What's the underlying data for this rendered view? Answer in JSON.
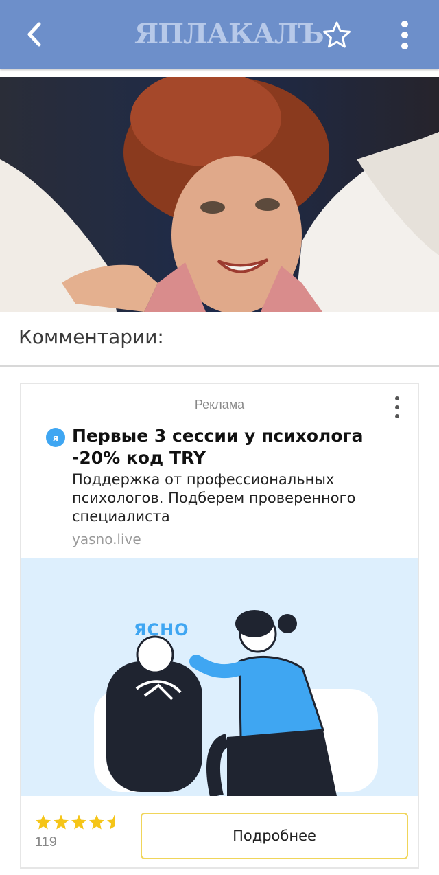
{
  "header": {
    "logo_text": "ЯПЛАКАЛЪ",
    "back_icon": "chevron-left-icon",
    "favorite_icon": "star-outline-icon",
    "menu_icon": "more-vertical-icon",
    "bar_color": "#6d8fca"
  },
  "post": {
    "image": "photo of smiling red-haired woman"
  },
  "comments": {
    "title": "Комментарии:"
  },
  "ad": {
    "label": "Реклама",
    "favicon_letter": "я",
    "title": "Первые 3 сессии у психолога -20% код TRY",
    "description": "Поддержка от профессиональных психологов. Подберем проверенного специалиста",
    "domain": "yasno.live",
    "image_brand": "ЯСНО",
    "rating_value": 4.5,
    "rating_count": "119",
    "cta_label": "Подробнее",
    "accent_color": "#3fa6f2",
    "star_color": "#f5c518"
  }
}
